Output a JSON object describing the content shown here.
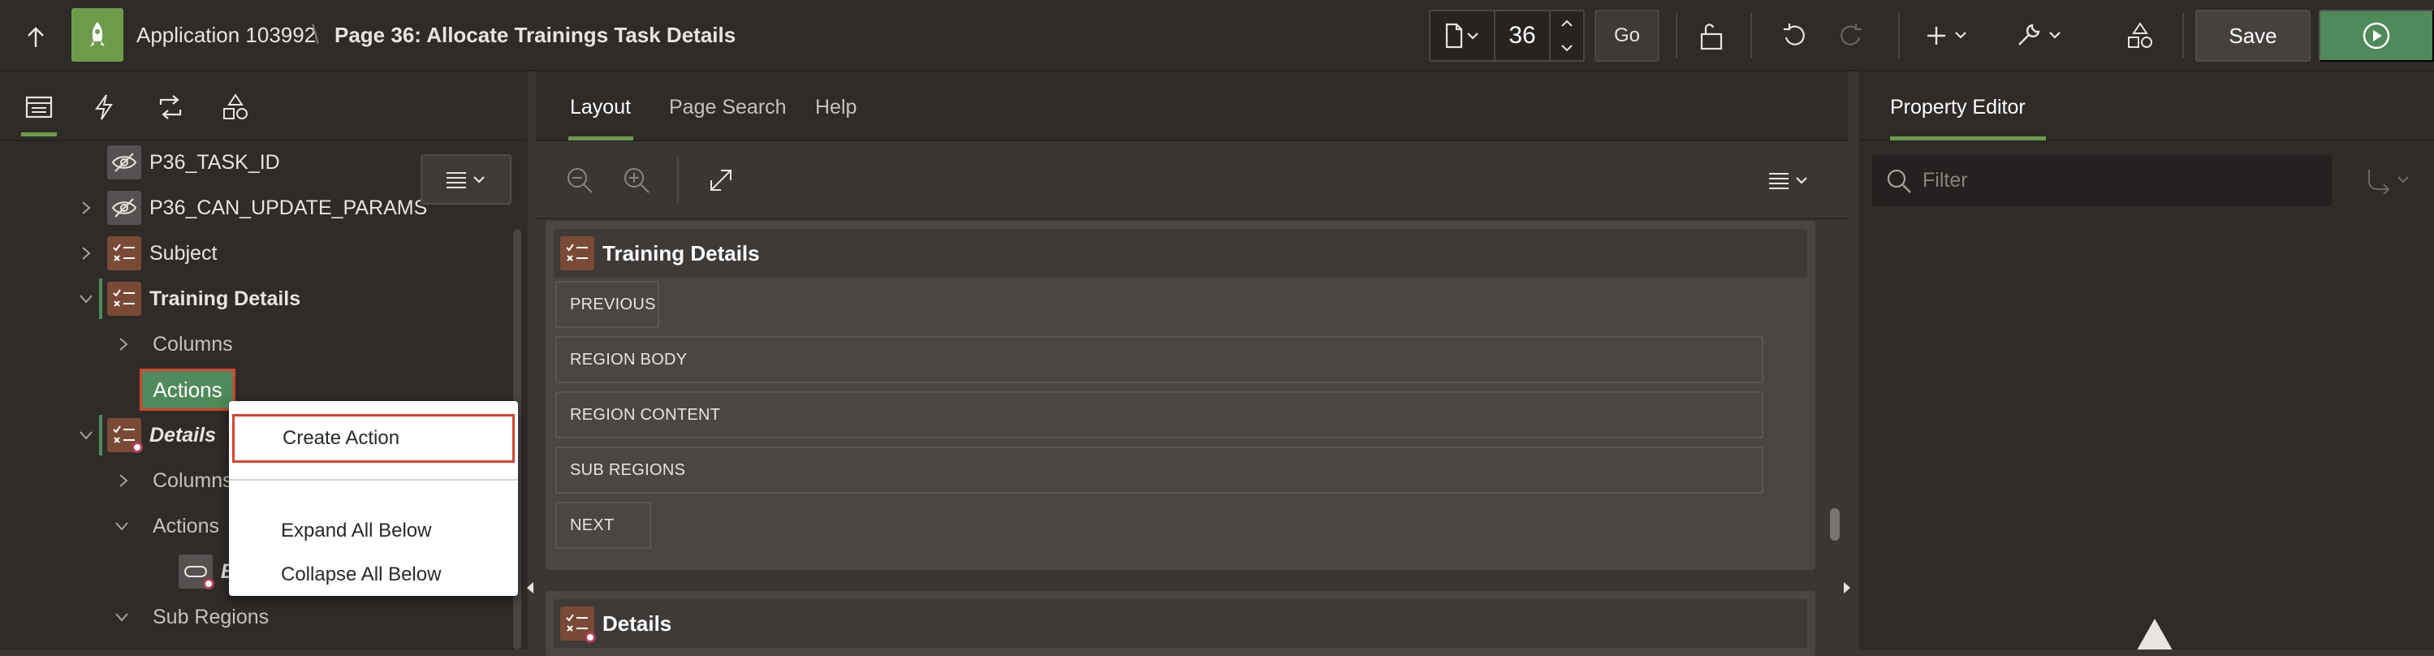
{
  "header": {
    "app_title": "Application 103992",
    "separator": "\\",
    "page_title": "Page 36: Allocate Trainings Task Details",
    "page_number": "36",
    "go_label": "Go",
    "save_label": "Save"
  },
  "left_tree": {
    "items": [
      {
        "label": "P36_TASK_ID"
      },
      {
        "label": "P36_CAN_UPDATE_PARAMS"
      },
      {
        "label": "Subject"
      },
      {
        "label": "Training Details"
      },
      {
        "label": "Columns"
      },
      {
        "label": "Actions"
      },
      {
        "label": "Details"
      },
      {
        "label": "Columns"
      },
      {
        "label": "Actions"
      },
      {
        "label": "B"
      },
      {
        "label": "Sub Regions"
      }
    ]
  },
  "context_menu": {
    "items": [
      {
        "label": "Create Action"
      },
      {
        "label": "Expand All Below"
      },
      {
        "label": "Collapse All Below"
      }
    ]
  },
  "middle": {
    "tabs": [
      {
        "label": "Layout"
      },
      {
        "label": "Page Search"
      },
      {
        "label": "Help"
      }
    ],
    "regions": [
      {
        "name": "Training Details",
        "slots": [
          "PREVIOUS",
          "REGION BODY",
          "REGION CONTENT",
          "SUB REGIONS",
          "NEXT"
        ]
      },
      {
        "name": "Details",
        "slots": []
      }
    ]
  },
  "right": {
    "tab_label": "Property Editor",
    "filter_placeholder": "Filter"
  },
  "colors": {
    "accent_green": "#6e9b4a",
    "selected_green": "#4f8a5a",
    "highlight_red": "#d9422b",
    "region_icon": "#7a4a36"
  }
}
